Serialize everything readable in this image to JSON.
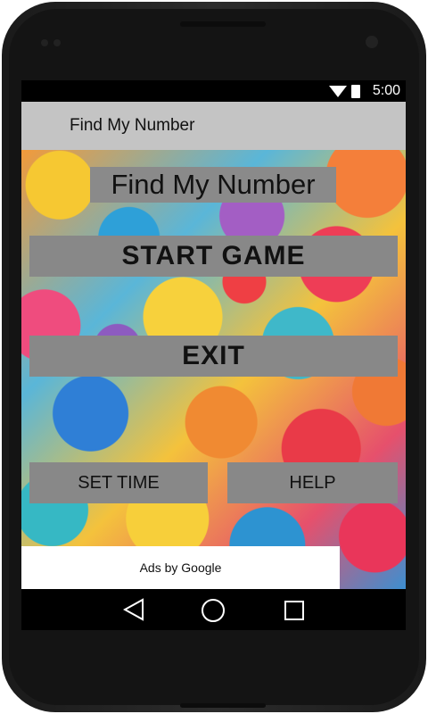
{
  "status_bar": {
    "time": "5:00",
    "icons": [
      "wifi-icon",
      "battery-icon"
    ]
  },
  "action_bar": {
    "title": "Find My Number"
  },
  "main": {
    "heading": "Find My Number",
    "start_label": "START GAME",
    "exit_label": "EXIT",
    "set_time_label": "SET TIME",
    "help_label": "HELP"
  },
  "ad": {
    "text": "Ads by Google"
  },
  "nav_bar": {
    "icons": [
      "back-icon",
      "home-icon",
      "recents-icon"
    ]
  },
  "colors": {
    "action_bar_bg": "#c4c4c4",
    "button_bg": "#888888",
    "status_bg": "#000000"
  }
}
